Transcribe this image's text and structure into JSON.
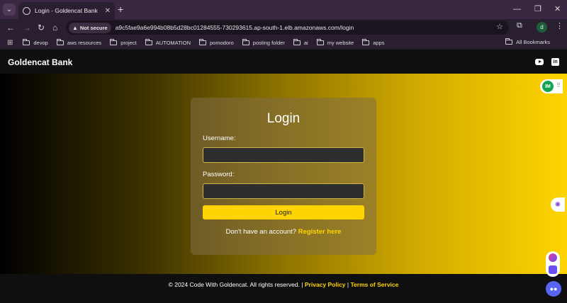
{
  "browser": {
    "tab": {
      "title": "Login - Goldencat Bank"
    },
    "security_label": "Not secure",
    "url": "a9c5fae9a6e994b08b5d28bc01284555-730293615.ap-south-1.elb.amazonaws.com/login",
    "profile_initial": "d",
    "bookmarks": [
      "devop",
      "aws resources",
      "project",
      "AUTOMATION",
      "pomodoro",
      "posting folder",
      "ai",
      "my website",
      "apps"
    ],
    "all_bookmarks": "All Bookmarks"
  },
  "site": {
    "brand": "Goldencat Bank",
    "login": {
      "title": "Login",
      "username_label": "Username:",
      "password_label": "Password:",
      "button": "Login",
      "register_prompt": "Don't have an account?",
      "register_link": "Register here"
    },
    "footer": {
      "copyright": "© 2024 Code With Goldencat. All rights reserved. |",
      "privacy": "Privacy Policy",
      "separator": "|",
      "terms": "Terms of Service"
    }
  },
  "widgets": {
    "im_badge": "IM"
  },
  "colors": {
    "accent": "#ffd400",
    "header_bg": "#0f0f0f",
    "card_bg": "#826e46"
  }
}
